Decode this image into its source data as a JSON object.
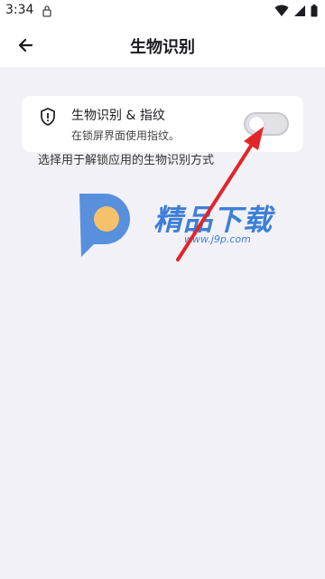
{
  "status_bar": {
    "time": "3:34",
    "lock_icon": "lock-icon",
    "wifi_icon": "wifi-icon",
    "signal_icon": "signal-icon",
    "battery_icon": "battery-icon"
  },
  "app_bar": {
    "title": "生物识别",
    "back_icon": "back-arrow-icon"
  },
  "setting": {
    "icon": "shield-icon",
    "title": "生物识别 & 指纹",
    "subtitle": "在锁屏界面使用指纹。",
    "enabled": false
  },
  "section_text": "选择用于解锁应用的生物识别方式",
  "watermark": {
    "text": "精品下载",
    "url": "www.j9p.com"
  },
  "colors": {
    "background": "#f2f1f7",
    "card": "#ffffff",
    "arrow": "#e0262a",
    "watermark": "#3d7fd8"
  }
}
